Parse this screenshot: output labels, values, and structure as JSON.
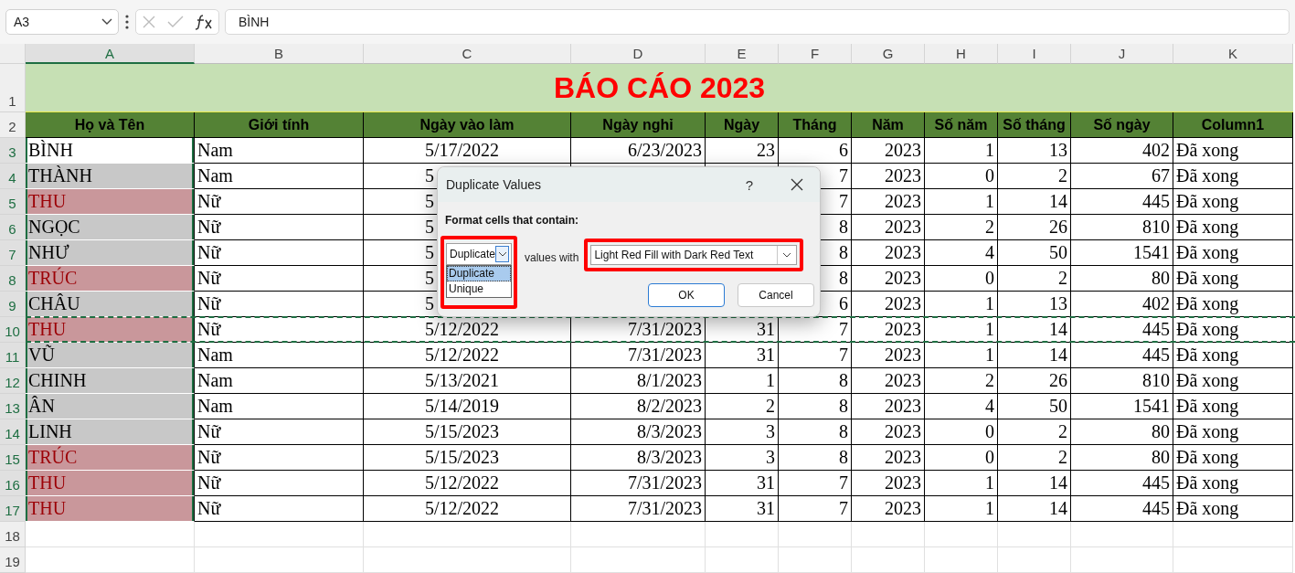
{
  "formula_bar": {
    "name_box": "A3",
    "formula": "BÌNH"
  },
  "column_letters": [
    {
      "label": "A",
      "selected": true
    },
    {
      "label": "B",
      "selected": false
    },
    {
      "label": "C",
      "selected": false
    },
    {
      "label": "D",
      "selected": false
    },
    {
      "label": "E",
      "selected": false
    },
    {
      "label": "F",
      "selected": false
    },
    {
      "label": "G",
      "selected": false
    },
    {
      "label": "H",
      "selected": false
    },
    {
      "label": "I",
      "selected": false
    },
    {
      "label": "J",
      "selected": false
    },
    {
      "label": "K",
      "selected": false
    }
  ],
  "title_row": {
    "num": "1",
    "title": "BÁO CÁO 2023"
  },
  "header_row": {
    "num": "2",
    "headers": [
      "Họ và Tên",
      "Giới tính",
      "Ngày vào làm",
      "Ngày nghỉ",
      "Ngày",
      "Tháng",
      "Năm",
      "Số năm",
      "Số tháng",
      "Số ngày",
      "Column1"
    ]
  },
  "rows": [
    {
      "num": "3",
      "selected": true,
      "active": true,
      "duplicate": false,
      "copied": false,
      "cells": [
        "BÌNH",
        "Nam",
        "5/17/2022",
        "6/23/2023",
        "23",
        "6",
        "2023",
        "1",
        "13",
        "402",
        "Đã xong"
      ]
    },
    {
      "num": "4",
      "selected": true,
      "active": false,
      "duplicate": false,
      "copied": false,
      "cells": [
        "THÀNH",
        "Nam",
        "5",
        null,
        null,
        "7",
        "2023",
        "0",
        "2",
        "67",
        "Đã xong"
      ]
    },
    {
      "num": "5",
      "selected": true,
      "active": false,
      "duplicate": true,
      "copied": false,
      "cells": [
        "THU",
        "Nữ",
        "5",
        null,
        null,
        "7",
        "2023",
        "1",
        "14",
        "445",
        "Đã xong"
      ]
    },
    {
      "num": "6",
      "selected": true,
      "active": false,
      "duplicate": false,
      "copied": false,
      "cells": [
        "NGỌC",
        "Nữ",
        "5",
        null,
        null,
        "8",
        "2023",
        "2",
        "26",
        "810",
        "Đã xong"
      ]
    },
    {
      "num": "7",
      "selected": true,
      "active": false,
      "duplicate": false,
      "copied": false,
      "cells": [
        "NHƯ",
        "Nữ",
        "5",
        null,
        null,
        "8",
        "2023",
        "4",
        "50",
        "1541",
        "Đã xong"
      ]
    },
    {
      "num": "8",
      "selected": true,
      "active": false,
      "duplicate": true,
      "copied": false,
      "cells": [
        "TRÚC",
        "Nữ",
        "5",
        null,
        null,
        "8",
        "2023",
        "0",
        "2",
        "80",
        "Đã xong"
      ]
    },
    {
      "num": "9",
      "selected": true,
      "active": false,
      "duplicate": false,
      "copied": false,
      "cells": [
        "CHÂU",
        "Nữ",
        "5",
        null,
        null,
        "6",
        "2023",
        "1",
        "13",
        "402",
        "Đã xong"
      ]
    },
    {
      "num": "10",
      "selected": true,
      "active": false,
      "duplicate": true,
      "copied": true,
      "cells": [
        "THU",
        "Nữ",
        "5/12/2022",
        "7/31/2023",
        "31",
        "7",
        "2023",
        "1",
        "14",
        "445",
        "Đã xong"
      ]
    },
    {
      "num": "11",
      "selected": true,
      "active": false,
      "duplicate": false,
      "copied": false,
      "cells": [
        "VŨ",
        "Nam",
        "5/12/2022",
        "7/31/2023",
        "31",
        "7",
        "2023",
        "1",
        "14",
        "445",
        "Đã xong"
      ]
    },
    {
      "num": "12",
      "selected": true,
      "active": false,
      "duplicate": false,
      "copied": false,
      "cells": [
        "CHINH",
        "Nam",
        "5/13/2021",
        "8/1/2023",
        "1",
        "8",
        "2023",
        "2",
        "26",
        "810",
        "Đã xong"
      ]
    },
    {
      "num": "13",
      "selected": true,
      "active": false,
      "duplicate": false,
      "copied": false,
      "cells": [
        "ÂN",
        "Nam",
        "5/14/2019",
        "8/2/2023",
        "2",
        "8",
        "2023",
        "4",
        "50",
        "1541",
        "Đã xong"
      ]
    },
    {
      "num": "14",
      "selected": true,
      "active": false,
      "duplicate": false,
      "copied": false,
      "cells": [
        "LINH",
        "Nữ",
        "5/15/2023",
        "8/3/2023",
        "3",
        "8",
        "2023",
        "0",
        "2",
        "80",
        "Đã xong"
      ]
    },
    {
      "num": "15",
      "selected": true,
      "active": false,
      "duplicate": true,
      "copied": false,
      "cells": [
        "TRÚC",
        "Nữ",
        "5/15/2023",
        "8/3/2023",
        "3",
        "8",
        "2023",
        "0",
        "2",
        "80",
        "Đã xong"
      ]
    },
    {
      "num": "16",
      "selected": true,
      "active": false,
      "duplicate": true,
      "copied": false,
      "cells": [
        "THU",
        "Nữ",
        "5/12/2022",
        "7/31/2023",
        "31",
        "7",
        "2023",
        "1",
        "14",
        "445",
        "Đã xong"
      ]
    },
    {
      "num": "17",
      "selected": true,
      "active": false,
      "duplicate": true,
      "copied": false,
      "cells": [
        "THU",
        "Nữ",
        "5/12/2022",
        "7/31/2023",
        "31",
        "7",
        "2023",
        "1",
        "14",
        "445",
        "Đã xong"
      ]
    }
  ],
  "empty_rows": [
    "18",
    "19"
  ],
  "dialog": {
    "title": "Duplicate Values",
    "help": "?",
    "heading": "Format cells that contain:",
    "type_select": {
      "value": "Duplicate",
      "expanded": true,
      "options": [
        {
          "label": "Duplicate",
          "selected": true
        },
        {
          "label": "Unique",
          "selected": false
        }
      ]
    },
    "connector": "values with",
    "format_select": {
      "value": "Light Red Fill with Dark Red Text"
    },
    "buttons": [
      {
        "label": "OK",
        "default": true
      },
      {
        "label": "Cancel",
        "default": false
      }
    ]
  }
}
